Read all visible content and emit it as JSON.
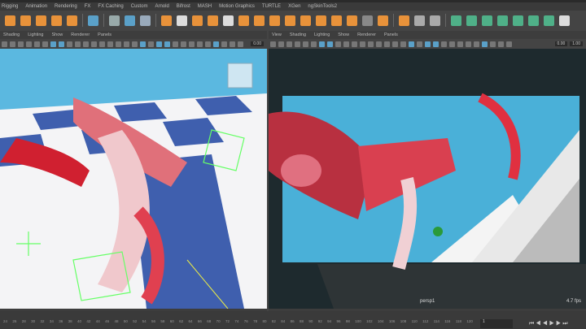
{
  "shelf_tabs": [
    "Rigging",
    "Animation",
    "Rendering",
    "FX",
    "FX Caching",
    "Custom",
    "Arnold",
    "Bifrost",
    "MASH",
    "Motion Graphics",
    "TURTLE",
    "XGen",
    "ngSkinTools2"
  ],
  "left_panel": {
    "menu": [
      "Shading",
      "Lighting",
      "Show",
      "Renderer",
      "Panels"
    ],
    "value": "0.00"
  },
  "right_panel": {
    "menu": [
      "View",
      "Shading",
      "Lighting",
      "Show",
      "Renderer",
      "Panels"
    ],
    "value1": "0.00",
    "value2": "1.00",
    "camera": "persp1",
    "fps": "4.7 fps"
  },
  "timeline": {
    "ticks": [
      "24",
      "26",
      "28",
      "30",
      "32",
      "34",
      "36",
      "38",
      "40",
      "42",
      "44",
      "46",
      "48",
      "50",
      "52",
      "54",
      "56",
      "58",
      "60",
      "62",
      "64",
      "66",
      "68",
      "70",
      "72",
      "74",
      "76",
      "78",
      "80",
      "82",
      "84",
      "86",
      "88",
      "90",
      "92",
      "94",
      "96",
      "98",
      "100",
      "102",
      "104",
      "106",
      "108",
      "110",
      "112",
      "114",
      "116",
      "118",
      "120"
    ],
    "current_frame": "1"
  },
  "colors": {
    "viewport_bg": "#5bb8e0",
    "checker_blue": "#3f5fae",
    "render_bg": "#1e2a2e",
    "accent": "#e8923a",
    "shelf_green": "#4fb088"
  }
}
